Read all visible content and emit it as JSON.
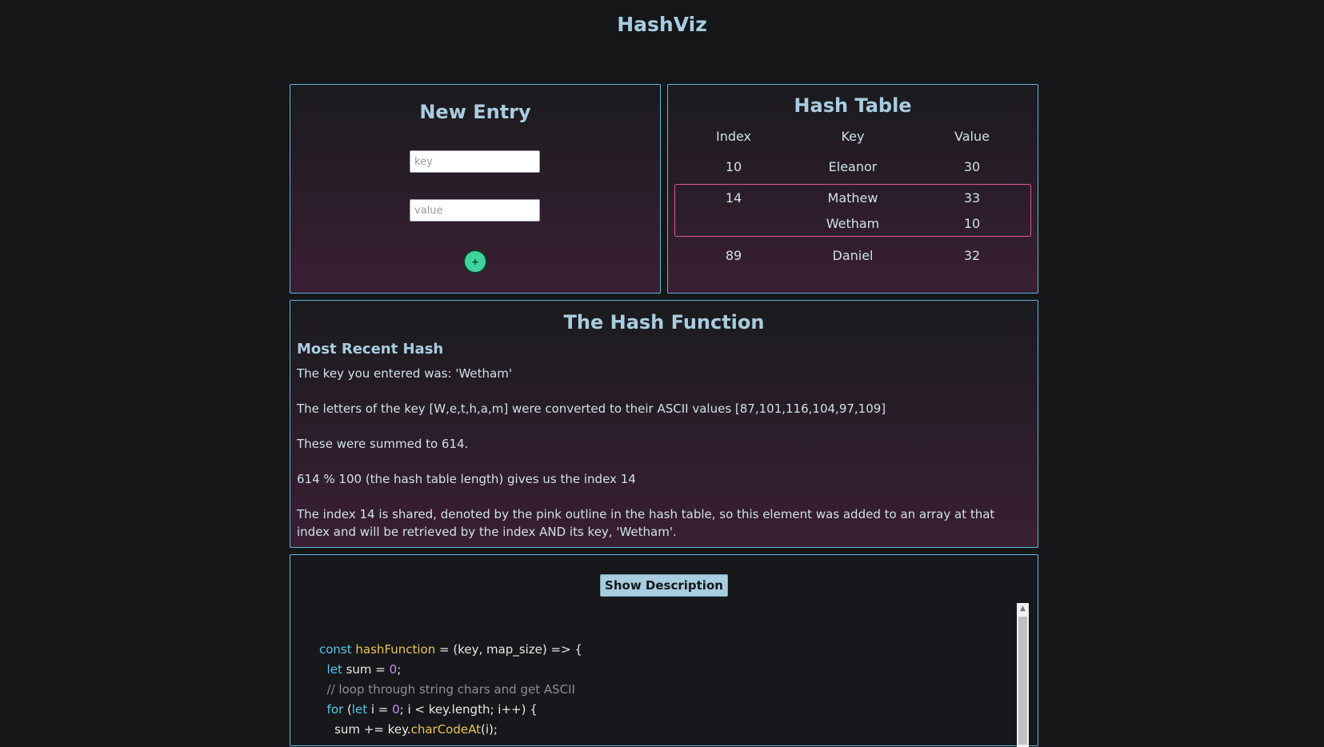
{
  "app": {
    "title": "HashViz"
  },
  "entry_panel": {
    "title": "New Entry",
    "key_placeholder": "key",
    "value_placeholder": "value",
    "add_label": "+"
  },
  "table_panel": {
    "title": "Hash Table",
    "headers": [
      "Index",
      "Key",
      "Value"
    ],
    "rows": [
      {
        "index": "10",
        "key": "Eleanor",
        "value": "30"
      },
      {
        "index": "14",
        "key": "Mathew",
        "value": "33"
      },
      {
        "index": "",
        "key": "Wetham",
        "value": "10"
      },
      {
        "index": "89",
        "key": "Daniel",
        "value": "32"
      }
    ],
    "collision_color": "#e0559c"
  },
  "hash_panel": {
    "title": "The Hash Function",
    "subtitle": "Most Recent Hash",
    "lines": [
      "The key you entered was: 'Wetham'",
      "The letters of the key [W,e,t,h,a,m] were converted to their ASCII values [87,101,116,104,97,109]",
      "These were summed to 614.",
      "614 % 100 (the hash table length) gives us the index 14",
      "The index 14 is shared, denoted by the pink outline in the hash table, so this element was added to an array at that index and will be retrieved by the index AND its key, 'Wetham'."
    ]
  },
  "code_panel": {
    "button_label": "Show Description",
    "code": {
      "l1_kw": "const",
      "l1_fn": "hashFunction",
      "l1_rest": " = (key, map_size) => {",
      "l2_kw": "let",
      "l2_mid": " sum = ",
      "l2_num": "0",
      "l2_end": ";",
      "l3_comment": "// loop through string chars and get ASCII",
      "l4_kw": "for",
      "l4_a": " (",
      "l4_kw2": "let",
      "l4_b": " i = ",
      "l4_num": "0",
      "l4_c": "; i < key.length; i++) {",
      "l5_a": "sum += key.",
      "l5_fn": "charCodeAt",
      "l5_b": "(i);"
    }
  },
  "colors": {
    "accent": "#5fb6dc",
    "title": "#a9cde0",
    "add_button": "#3fd39c"
  }
}
